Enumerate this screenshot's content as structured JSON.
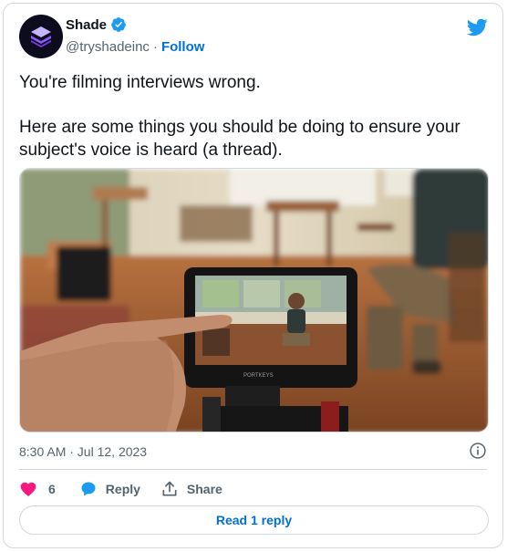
{
  "author": {
    "name": "Shade",
    "handle": "@tryshadeinc",
    "separator": "·",
    "follow_label": "Follow",
    "verified": true
  },
  "tweet": {
    "line1": "You're filming interviews wrong.",
    "line2": "Here are some things you should be doing to ensure your subject's voice is heard (a thread)."
  },
  "media": {
    "monitor_brand": "PORTKEYS"
  },
  "timestamp": "8:30 AM · Jul 12, 2023",
  "actions": {
    "like_count": "6",
    "reply_label": "Reply",
    "share_label": "Share"
  },
  "read_replies_label": "Read 1 reply",
  "colors": {
    "accent": "#1d9bf0",
    "like": "#f91880",
    "text": "#0f1419",
    "muted": "#536471",
    "border": "#cfd9de",
    "avatar_bg": "#0d0b1e",
    "logo_purple": "#8b5cf6"
  },
  "icons": {
    "logo": "shade-logo-icon",
    "verified": "verified-badge-icon",
    "platform": "twitter-bird-icon",
    "info": "info-icon",
    "like": "heart-icon",
    "reply": "speech-bubble-icon",
    "share": "share-upload-icon"
  }
}
